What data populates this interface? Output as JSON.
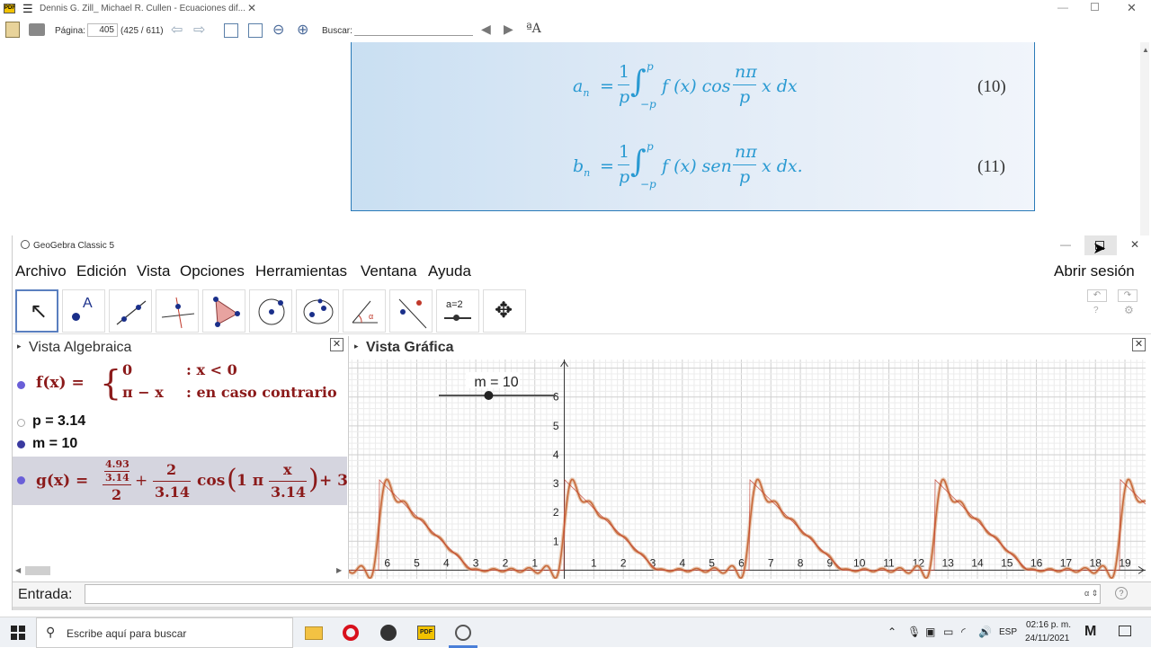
{
  "pdf": {
    "title": "Dennis G. Zill_ Michael R. Cullen - Ecuaciones dif...",
    "page_label": "Página:",
    "page_value": "405",
    "page_count": "(425 / 611)",
    "search_label": "Buscar:",
    "eq10_lhs": "a",
    "eq10_sub": "n",
    "eq10_rhs": "f (x) cos",
    "eq10_tail": "x dx",
    "eq10_num": "(10)",
    "eq11_lhs": "b",
    "eq11_sub": "n",
    "eq11_rhs": "f (x) sen",
    "eq11_tail": "x dx.",
    "eq11_num": "(11)",
    "frac_num": "1",
    "frac_den": "p",
    "frac2_num": "nπ",
    "frac2_den": "p",
    "int_top": "p",
    "int_bot": "−p",
    "eq_sign": "="
  },
  "geogebra": {
    "title": "GeoGebra Classic 5",
    "menu": [
      "Archivo",
      "Edición",
      "Vista",
      "Opciones",
      "Herramientas",
      "Ventana",
      "Ayuda"
    ],
    "signin": "Abrir sesión",
    "tool_slider_label": "a=2",
    "algebra": {
      "title": "Vista Algebraica",
      "f_name": "f(x) =",
      "f_case1_expr": "0",
      "f_case1_cond": ": x < 0",
      "f_case2_expr": "π − x",
      "f_case2_cond": ": en caso contrario",
      "p_def": "p = 3.14",
      "m_def": "m = 10",
      "g_name": "g(x) =",
      "g_frac_top_num": "4.93",
      "g_frac_top_den": "3.14",
      "g_frac_den": "2",
      "g_plus": "+",
      "g_coef_num": "2",
      "g_coef_den": "3.14",
      "g_cos": "cos",
      "g_arg1": "1 π",
      "g_arg_num": "x",
      "g_arg_den": "3.14",
      "g_tail": "+ 3"
    },
    "graphics": {
      "title": "Vista Gráfica",
      "slider_label": "m = 10",
      "slider_value": 10,
      "slider_min": 1,
      "slider_max": 20
    },
    "input_label": "Entrada:"
  },
  "chart_data": {
    "type": "line",
    "series": [
      {
        "name": "f",
        "color": "#c0392b"
      },
      {
        "name": "g",
        "color": "#c86a3c"
      }
    ],
    "xlim": [
      -7.3,
      19.7
    ],
    "ylim": [
      -0.3,
      7.3
    ],
    "x_ticks": [
      -6,
      -5,
      -4,
      -3,
      -2,
      -1,
      1,
      2,
      3,
      4,
      5,
      6,
      7,
      8,
      9,
      10,
      11,
      12,
      13,
      14,
      15,
      16,
      17,
      18,
      19
    ],
    "x_tick_labels": [
      "6",
      "5",
      "4",
      "3",
      "2",
      "1",
      "1",
      "2",
      "3",
      "4",
      "5",
      "6",
      "7",
      "8",
      "9",
      "10",
      "11",
      "12",
      "13",
      "14",
      "15",
      "16",
      "17",
      "18",
      "19"
    ],
    "y_ticks": [
      1,
      2,
      3,
      4,
      5,
      6
    ],
    "grid": true,
    "period": 6.28,
    "p": 3.14,
    "m": 10
  },
  "taskbar": {
    "search_placeholder": "Escribe aquí para buscar",
    "lang": "ESP",
    "time": "02:16 p. m.",
    "date": "24/11/2021"
  }
}
